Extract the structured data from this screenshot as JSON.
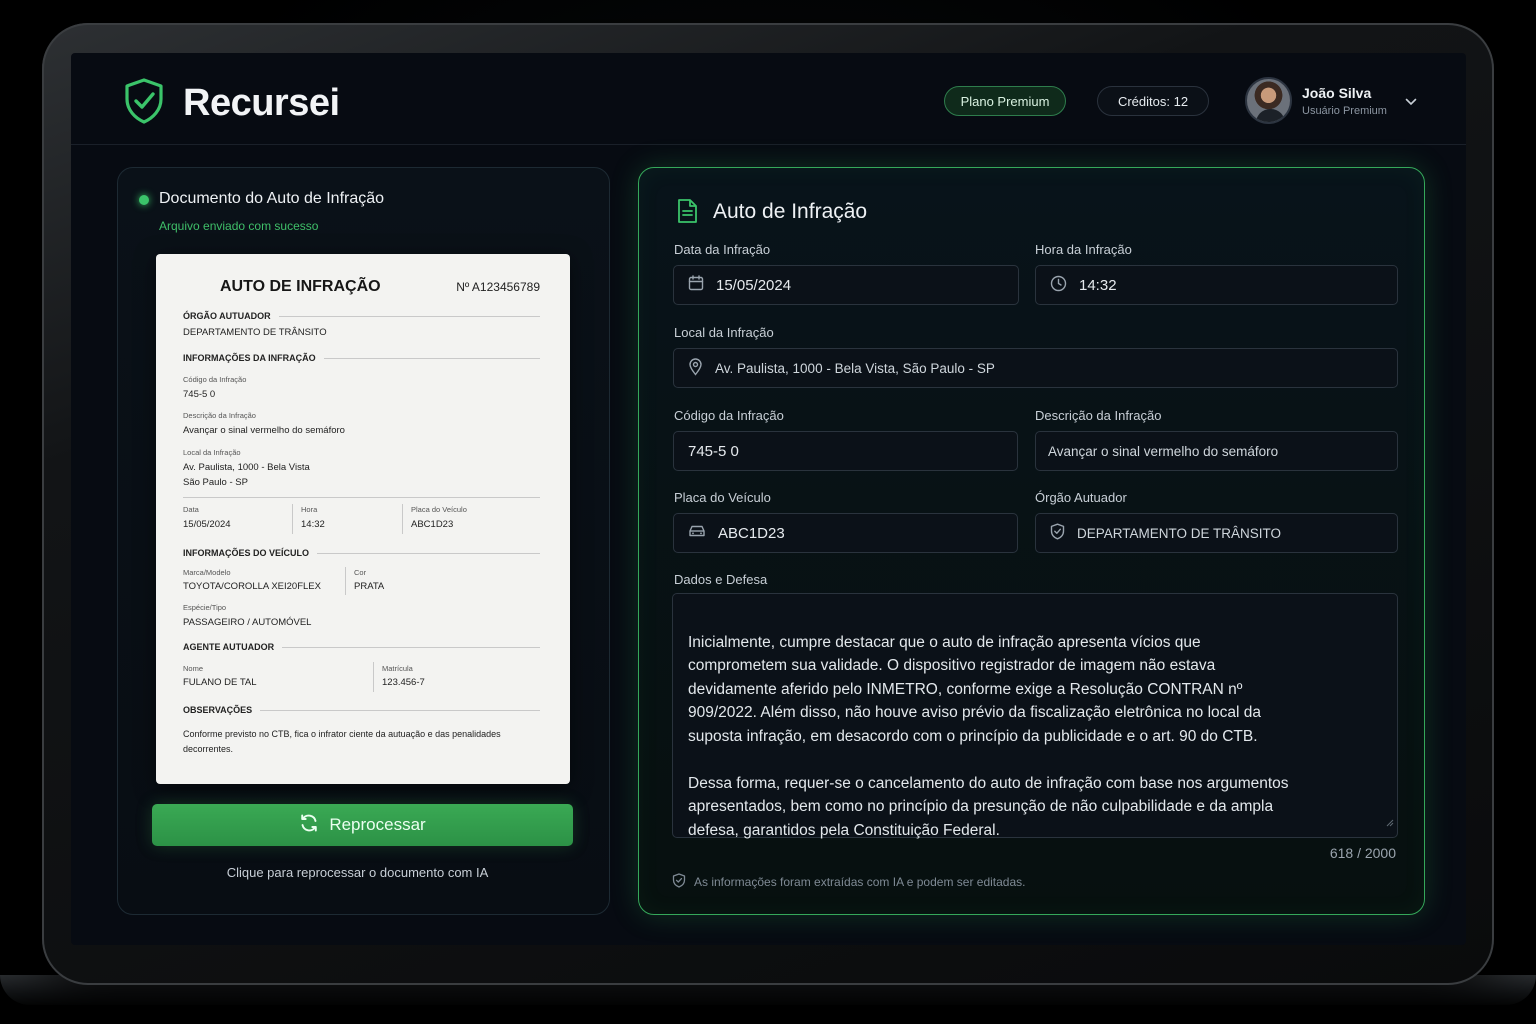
{
  "header": {
    "brand": "Recursei",
    "plan_badge": "Plano Premium",
    "credits": "Créditos: 12",
    "user_name": "João Silva",
    "user_role": "Usuário Premium"
  },
  "left": {
    "title": "Documento do Auto de Infração",
    "status": "Arquivo enviado com sucesso",
    "reprocess_label": "Reprocessar",
    "reprocess_hint": "Clique para reprocessar o documento com IA",
    "document": {
      "title": "AUTO DE INFRAÇÃO",
      "number": "Nº A123456789",
      "orgao_header": "ÓRGÃO AUTUADOR",
      "orgao_value": "DEPARTAMENTO DE TRÂNSITO",
      "info_header": "INFORMAÇÕES DA INFRAÇÃO",
      "codigo_label": "Código da Infração",
      "codigo_value": "745-5  0",
      "descricao_label": "Descrição da Infração",
      "descricao_value": "Avançar o sinal vermelho do semáforo",
      "local_label": "Local da Infração",
      "local_line1": "Av. Paulista, 1000 - Bela Vista",
      "local_line2": "São Paulo - SP",
      "data_label": "Data",
      "data_value": "15/05/2024",
      "hora_label": "Hora",
      "hora_value": "14:32",
      "placa_label": "Placa do Veículo",
      "placa_value": "ABC1D23",
      "veiculo_header": "INFORMAÇÕES DO VEÍCULO",
      "marca_label": "Marca/Modelo",
      "marca_value": "TOYOTA/COROLLA XEI20FLEX",
      "cor_label": "Cor",
      "cor_value": "PRATA",
      "especie_label": "Espécie/Tipo",
      "especie_value": "PASSAGEIRO / AUTOMÓVEL",
      "agente_header": "AGENTE AUTUADOR",
      "nome_label": "Nome",
      "nome_value": "FULANO DE TAL",
      "matricula_label": "Matrícula",
      "matricula_value": "123.456-7",
      "obs_header": "OBSERVAÇÕES",
      "obs_line1": "Conforme previsto no CTB, fica o infrator ciente da autuação e das penalidades",
      "obs_line2": "decorrentes."
    }
  },
  "form": {
    "title": "Auto de Infração",
    "data_label": "Data da Infração",
    "data_value": "15/05/2024",
    "hora_label": "Hora da Infração",
    "hora_value": "14:32",
    "local_label": "Local da Infração",
    "local_value": "Av. Paulista, 1000 - Bela Vista, São Paulo - SP",
    "codigo_label": "Código da Infração",
    "codigo_value": "745-5 0",
    "descricao_label": "Descrição da Infração",
    "descricao_value": "Avançar o sinal vermelho do semáforo",
    "placa_label": "Placa do Veículo",
    "placa_value": "ABC1D23",
    "orgao_label": "Órgão Autuador",
    "orgao_value": "DEPARTAMENTO DE TRÂNSITO",
    "defesa_label": "Dados e Defesa",
    "defesa_text": "Inicialmente, cumpre destacar que o auto de infração apresenta vícios que comprometem sua validade. O dispositivo registrador de imagem não estava devidamente aferido pelo INMETRO, conforme exige a Resolução CONTRAN nº 909/2022. Além disso, não houve aviso prévio da fiscalização eletrônica no local da suposta infração, em desacordo com o princípio da publicidade e o art. 90 do CTB.\n\nDessa forma, requer-se o cancelamento do auto de infração com base nos argumentos apresentados, bem como no princípio da presunção de não culpabilidade e da ampla defesa, garantidos pela Constituição Federal.",
    "counter": "618 / 2000",
    "ai_note": "As informações foram extraídas com IA e podem ser editadas."
  },
  "colors": {
    "accent_green": "#3bc46a",
    "background": "#070b12"
  }
}
